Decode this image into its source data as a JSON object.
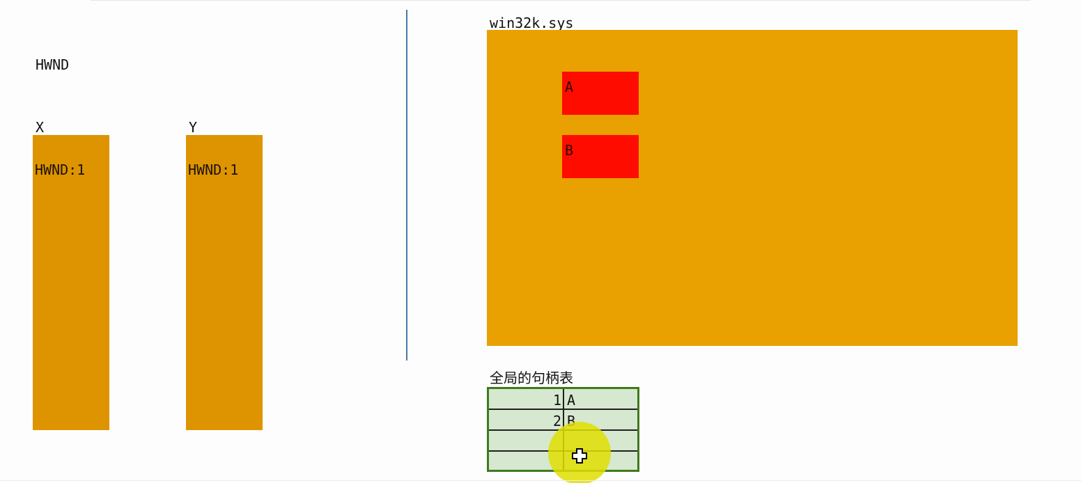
{
  "left_panel": {
    "title": "HWND",
    "columns": [
      {
        "header": "X",
        "cell": "HWND:1"
      },
      {
        "header": "Y",
        "cell": "HWND:1"
      }
    ]
  },
  "right_panel": {
    "kernel_label": "win32k.sys",
    "objects": [
      "A",
      "B"
    ],
    "handle_table": {
      "title": "全局的句柄表",
      "rows": [
        {
          "index": "1",
          "ref": "A"
        },
        {
          "index": "2",
          "ref": "B"
        },
        {
          "index": "",
          "ref": ""
        },
        {
          "index": "",
          "ref": ""
        }
      ]
    }
  },
  "colors": {
    "column_fill": "#de9400",
    "kernel_fill": "#e8a100",
    "object_fill": "#ff0c00",
    "table_fill": "#d6e8cf",
    "table_border": "#3e7a1e",
    "divider": "#4a78a8",
    "cursor_highlight": "#e1de00"
  },
  "icons": {
    "cursor": "move-cursor-icon"
  }
}
